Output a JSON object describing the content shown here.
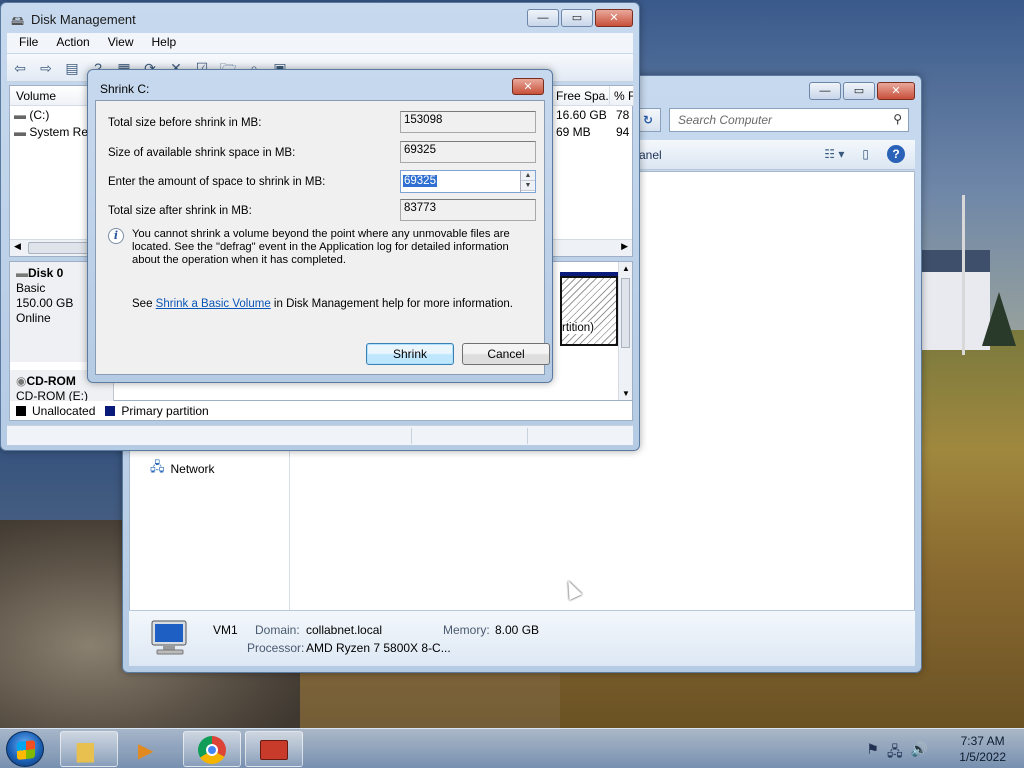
{
  "explorer": {
    "search_placeholder": "Search Computer",
    "cmd_partial": "anel",
    "nav_network": "Network",
    "details": {
      "name": "VM1",
      "domain_label": "Domain:",
      "domain_value": "collabnet.local",
      "memory_label": "Memory:",
      "memory_value": "8.00 GB",
      "processor_label": "Processor:",
      "processor_value": "AMD Ryzen 7 5800X 8-C..."
    }
  },
  "diskmgmt": {
    "title": "Disk Management",
    "menu": [
      "File",
      "Action",
      "View",
      "Help"
    ],
    "columns": {
      "volume": "Volume",
      "free": "Free Spa...",
      "pct": "% F"
    },
    "rows": [
      {
        "volume": "(C:)",
        "free": "16.60 GB",
        "pct": "78"
      },
      {
        "volume": "System Res",
        "free": "69 MB",
        "pct": "94"
      }
    ],
    "disk0": {
      "name": "Disk 0",
      "type": "Basic",
      "size": "150.00 GB",
      "status": "Online"
    },
    "partition_partial": "rtition)",
    "cdrom": {
      "name": "CD-ROM",
      "drive": "CD-ROM (E:)"
    },
    "legend": {
      "unallocated": "Unallocated",
      "primary": "Primary partition"
    }
  },
  "shrink": {
    "title": "Shrink C:",
    "fields": [
      {
        "label": "Total size before shrink in MB:",
        "value": "153098"
      },
      {
        "label": "Size of available shrink space in MB:",
        "value": "69325"
      },
      {
        "label": "Enter the amount of space to shrink in MB:",
        "value": "69325"
      },
      {
        "label": "Total size after shrink in MB:",
        "value": "83773"
      }
    ],
    "info_text": "You cannot shrink a volume beyond the point where any unmovable files are located. See the \"defrag\" event in the Application log for detailed information about the operation when it has completed.",
    "see_prefix": "See ",
    "see_link": "Shrink a Basic Volume",
    "see_suffix": " in Disk Management help for more information.",
    "shrink_button": "Shrink",
    "cancel_button": "Cancel"
  },
  "taskbar": {
    "time": "7:37 AM",
    "date": "1/5/2022"
  },
  "icons": {
    "minimize": "—",
    "maximize": "▭",
    "close": "✕"
  }
}
